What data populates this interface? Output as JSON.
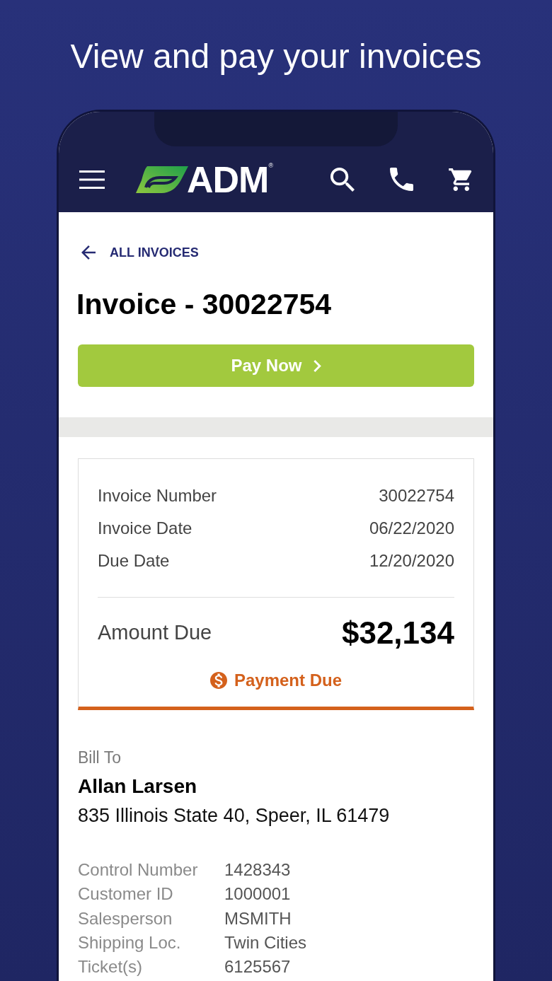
{
  "headline": "View and pay your invoices",
  "app_bar": {
    "logo": {
      "text": "ADM",
      "mark": "®"
    }
  },
  "back_link": "ALL INVOICES",
  "title": "Invoice - 30022754",
  "pay_button": "Pay Now",
  "summary": {
    "rows": [
      {
        "label": "Invoice Number",
        "value": "30022754"
      },
      {
        "label": "Invoice Date",
        "value": "06/22/2020"
      },
      {
        "label": "Due Date",
        "value": "12/20/2020"
      }
    ],
    "amount": {
      "label": "Amount Due",
      "value": "$32,134"
    },
    "status": {
      "kind": "due",
      "label": "Payment Due"
    }
  },
  "bill_to": {
    "heading": "Bill To",
    "name": "Allan Larsen",
    "address": "835 Illinois State 40, Speer, IL 61479"
  },
  "details": [
    {
      "label": "Control Number",
      "value": "1428343"
    },
    {
      "label": "Customer ID",
      "value": "1000001"
    },
    {
      "label": "Salesperson",
      "value": "MSMITH"
    },
    {
      "label": "Shipping Loc.",
      "value": "Twin Cities"
    },
    {
      "label": "Ticket(s)",
      "value": "6125567"
    }
  ]
}
